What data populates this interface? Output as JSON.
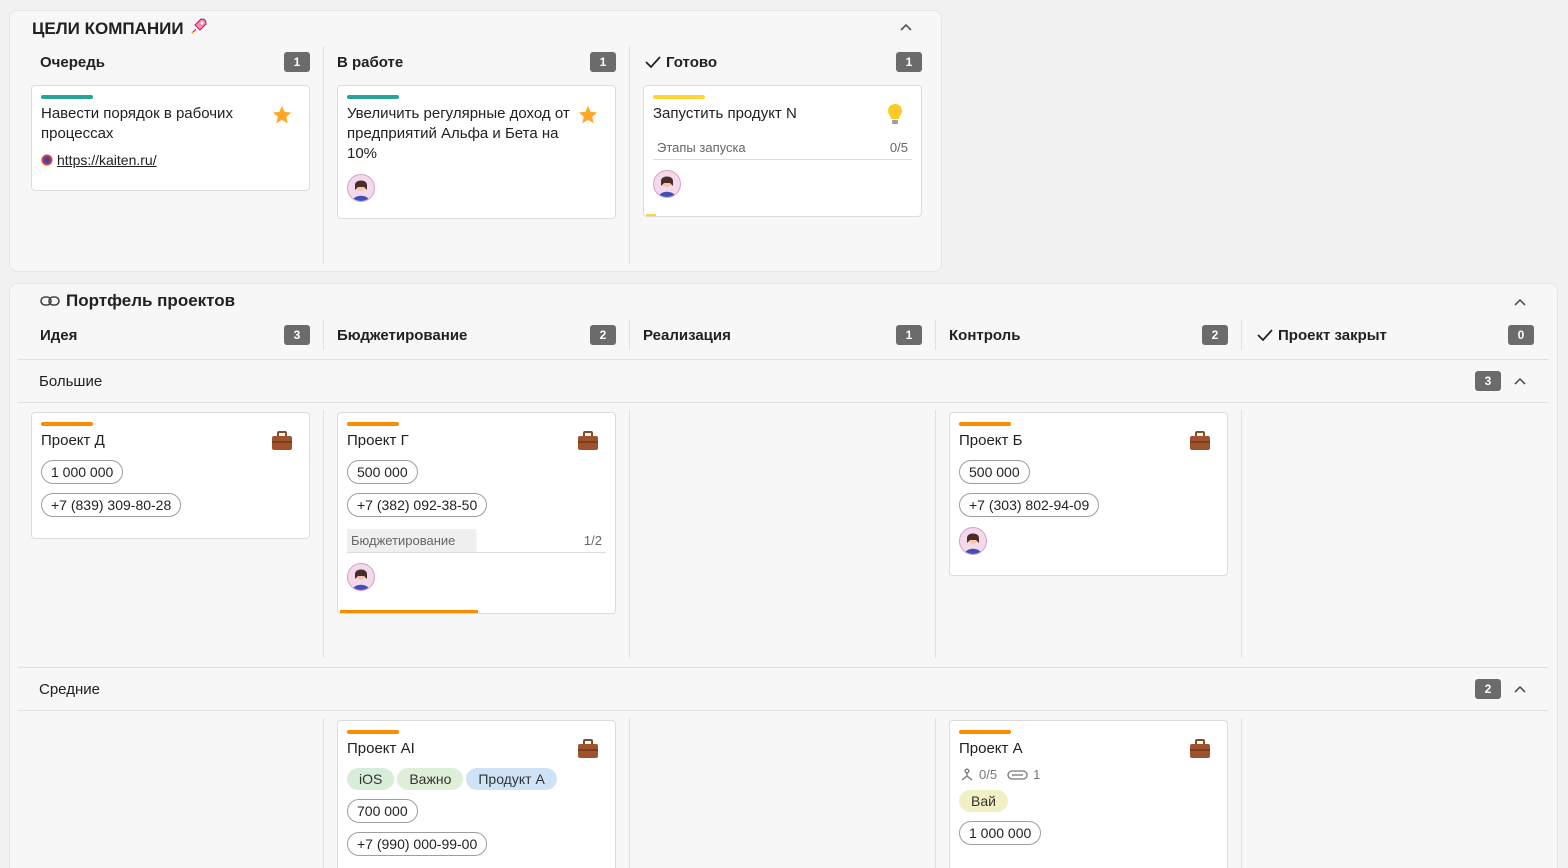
{
  "goals": {
    "title": "ЦЕЛИ КОМПАНИИ",
    "columns": [
      {
        "name": "Очередь",
        "count": "1"
      },
      {
        "name": "В работе",
        "count": "1"
      },
      {
        "name": "Готово",
        "count": "1"
      }
    ],
    "cards": [
      {
        "title": "Навести порядок в рабочих процессах",
        "link": "https://kaiten.ru/"
      },
      {
        "title": "Увеличить регулярные доход от предприятий Альфа и Бета на 10%"
      },
      {
        "title": "Запустить продукт N",
        "checklist_name": "Этапы запуска",
        "checklist_progress": "0/5"
      }
    ]
  },
  "portfolio": {
    "title": "Портфель проектов",
    "columns": [
      {
        "name": "Идея",
        "count": "3"
      },
      {
        "name": "Бюджетирование",
        "count": "2"
      },
      {
        "name": "Реализация",
        "count": "1"
      },
      {
        "name": "Контроль",
        "count": "2"
      },
      {
        "name": "Проект закрыт",
        "count": "0"
      }
    ],
    "lanes": [
      {
        "name": "Большие",
        "count": "3"
      },
      {
        "name": "Средние",
        "count": "2"
      }
    ],
    "cards": {
      "d": {
        "title": "Проект Д",
        "amount": "1 000 000",
        "phone": "+7 (839) 309-80-28"
      },
      "g": {
        "title": "Проект Г",
        "amount": "500 000",
        "phone": "+7 (382) 092-38-50",
        "checklist_name": "Бюджетирование",
        "checklist_progress": "1/2"
      },
      "b": {
        "title": "Проект Б",
        "amount": "500 000",
        "phone": "+7 (303) 802-94-09"
      },
      "ai": {
        "title": "Проект AI",
        "tags": [
          "iOS",
          "Важно",
          "Продукт А"
        ],
        "amount": "700 000",
        "phone": "+7 (990) 000-99-00"
      },
      "a": {
        "title": "Проект А",
        "subtasks": "0/5",
        "attachments": "1",
        "tag": "Вай",
        "amount": "1 000 000"
      }
    }
  },
  "colors": {
    "teal": "#26a69a",
    "yellow": "#fdd835",
    "orange": "#fb8c00",
    "star": "#ffa726",
    "briefcase": "#a0522d",
    "tag_ios": "#d7ecd9",
    "tag_important": "#dfeed8",
    "tag_product": "#cfe3f7",
    "tag_vai": "#f0f0c4"
  }
}
